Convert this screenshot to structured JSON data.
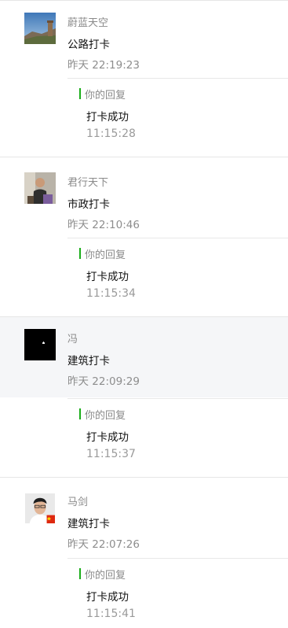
{
  "reply_label": "你的回复",
  "accent_color": "#1aad19",
  "comments": [
    {
      "name": "蔚蓝天空",
      "content": "公路打卡",
      "time": "昨天 22:19:23",
      "avatar": "landscape-photo",
      "reply": {
        "text": "打卡成功",
        "time": "11:15:28"
      }
    },
    {
      "name": "君行天下",
      "content": "市政打卡",
      "time": "昨天 22:10:46",
      "avatar": "person-photo",
      "reply": {
        "text": "打卡成功",
        "time": "11:15:34"
      }
    },
    {
      "name": "冯",
      "content": "建筑打卡",
      "time": "昨天 22:09:29",
      "avatar": "black-square",
      "reply": {
        "text": "打卡成功",
        "time": "11:15:37"
      }
    },
    {
      "name": "马剑",
      "content": "建筑打卡",
      "time": "昨天 22:07:26",
      "avatar": "portrait-photo",
      "reply": {
        "text": "打卡成功",
        "time": "11:15:41"
      }
    }
  ]
}
